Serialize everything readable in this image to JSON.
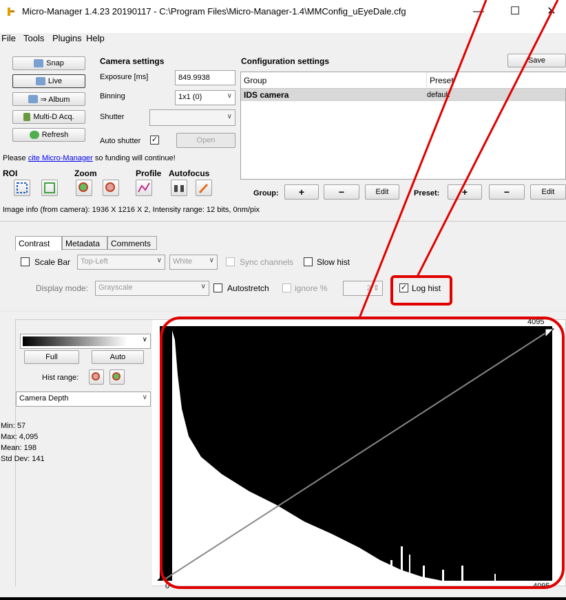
{
  "window": {
    "title": "Micro-Manager 1.4.23 20190117 - C:\\Program Files\\Micro-Manager-1.4\\MMConfig_uEyeDale.cfg",
    "minimize": "—",
    "maximize": "☐",
    "close": "✕"
  },
  "menu": [
    "File",
    "Tools",
    "Plugins",
    "Help"
  ],
  "left_buttons": {
    "snap": "Snap",
    "live": "Live",
    "album": "⇒ Album",
    "multid": "Multi-D Acq.",
    "refresh": "Refresh"
  },
  "camera": {
    "heading": "Camera settings",
    "exposure_label": "Exposure [ms]",
    "exposure_value": "849.9938",
    "binning_label": "Binning",
    "binning_value": "1x1 (0)",
    "shutter_label": "Shutter",
    "shutter_value": "",
    "auto_shutter_label": "Auto shutter",
    "open_button": "Open"
  },
  "cite": {
    "prefix": "Please ",
    "link": "cite Micro-Manager",
    "suffix": " so funding will continue!"
  },
  "tool_headings": {
    "roi": "ROI",
    "zoom": "Zoom",
    "profile": "Profile",
    "autofocus": "Autofocus"
  },
  "config": {
    "heading": "Configuration settings",
    "save_button": "Save",
    "columns": [
      "Group",
      "Preset"
    ],
    "rows": [
      {
        "group": "IDS camera",
        "preset": "default"
      }
    ],
    "group_label": "Group:",
    "preset_label": "Preset:",
    "plus": "+",
    "minus": "−",
    "edit": "Edit"
  },
  "image_info": "Image info (from camera): 1936 X 1216 X 2, Intensity range: 12 bits, 0nm/pix",
  "tabs": [
    "Contrast",
    "Metadata",
    "Comments"
  ],
  "contrast": {
    "scale_bar_label": "Scale Bar",
    "scale_bar_position": "Top-Left",
    "scale_bar_color": "White",
    "sync_channels_label": "Sync channels",
    "slow_hist_label": "Slow hist",
    "display_mode_label": "Display mode:",
    "display_mode_value": "Grayscale",
    "autostretch_label": "Autostretch",
    "ignore_label": "ignore %",
    "ignore_value": "2",
    "log_hist_label": "Log hist",
    "log_hist_checked": true
  },
  "hist_panel": {
    "full_button": "Full",
    "auto_button": "Auto",
    "hist_range_label": "Hist range:",
    "depth_value": "Camera Depth",
    "min": "Min: 57",
    "max": "Max: 4,095",
    "mean": "Mean: 198",
    "std": "Std Dev: 141",
    "axis_min": "0",
    "axis_max": "4095",
    "top_max": "4095"
  },
  "colors": {
    "annotation_red": "#e00000",
    "link_blue": "#0000ee",
    "selected_row": "#d8d8d8"
  }
}
